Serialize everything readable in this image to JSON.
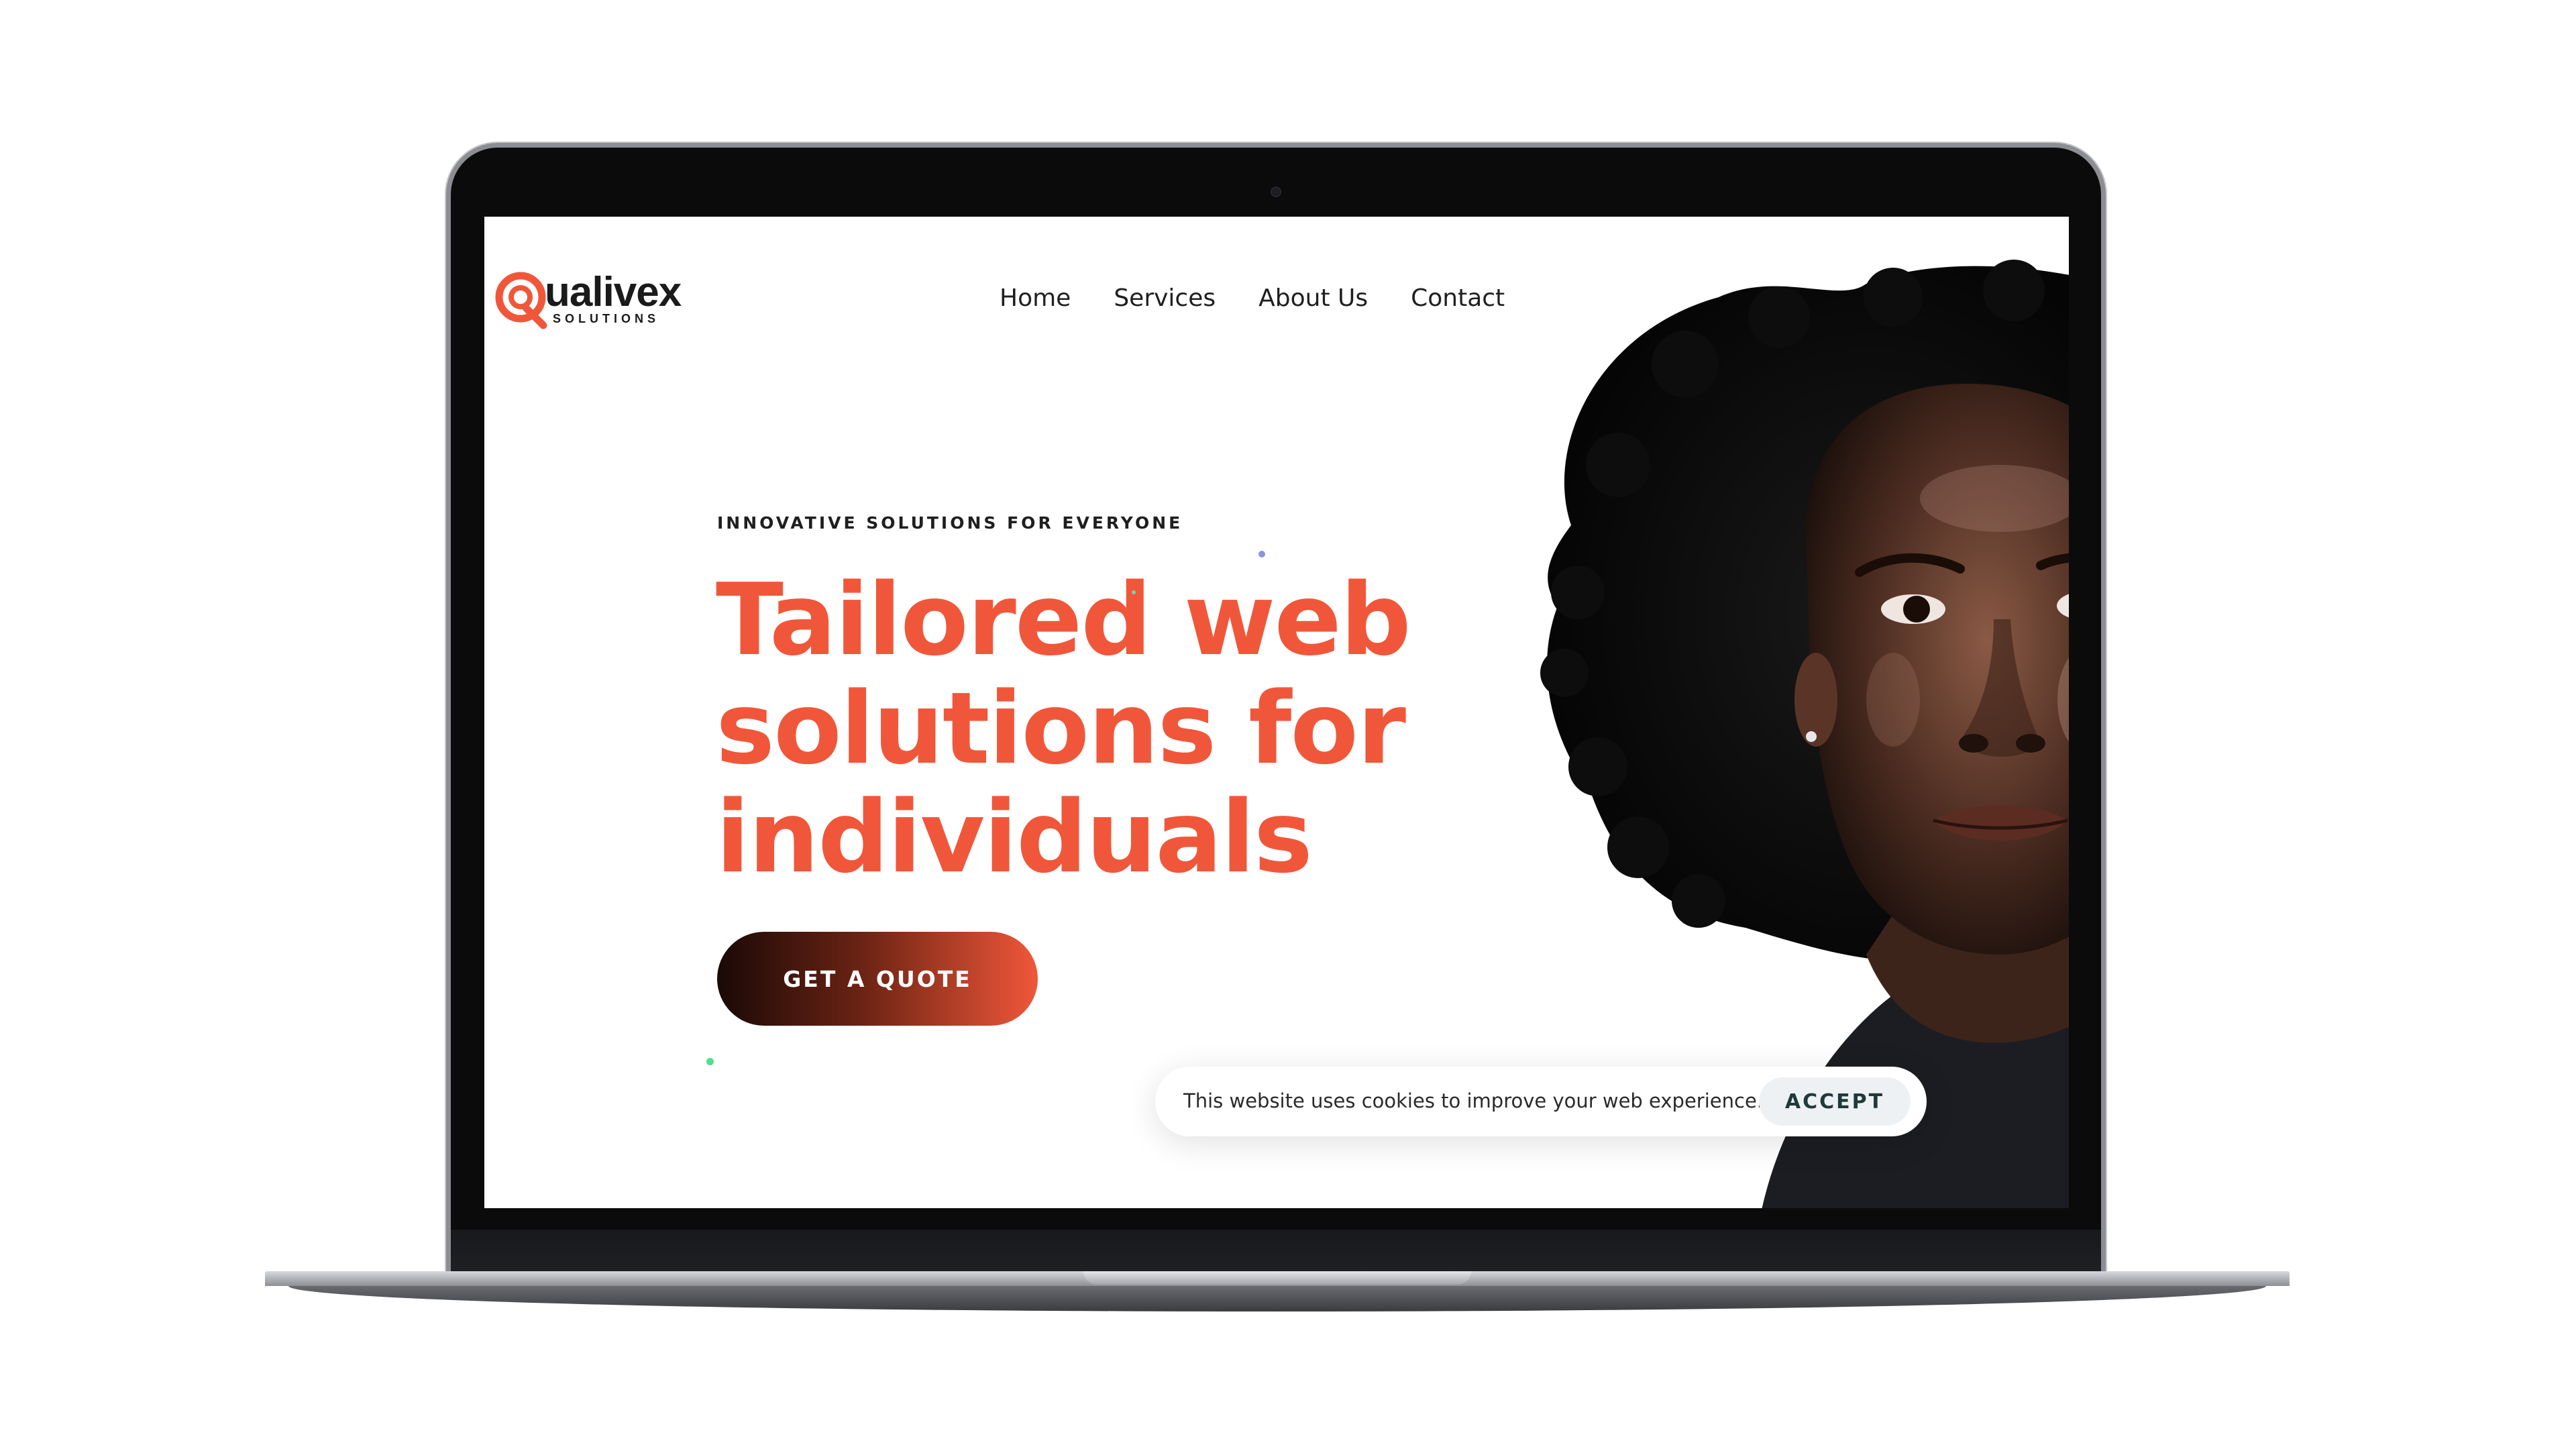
{
  "brand": {
    "name": "ualivex",
    "letter": "Q",
    "tagline": "SOLUTIONS",
    "accent": "#f0573a"
  },
  "nav": {
    "items": [
      {
        "label": "Home"
      },
      {
        "label": "Services"
      },
      {
        "label": "About Us"
      },
      {
        "label": "Contact"
      }
    ]
  },
  "hero": {
    "eyebrow": "INNOVATIVE SOLUTIONS FOR EVERYONE",
    "headline_line1": "Tailored web",
    "headline_line2": "solutions for",
    "headline_line3": "individuals",
    "cta_label": "GET A QUOTE",
    "portrait_icon": "portrait-woman-image"
  },
  "cookie": {
    "message": "This website uses cookies to improve your web experience.",
    "accept_label": "ACCEPT"
  },
  "colors": {
    "headline": "#f0573a",
    "text": "#1f1f1f",
    "cta_start": "#1a0906",
    "cta_end": "#f0573a"
  }
}
